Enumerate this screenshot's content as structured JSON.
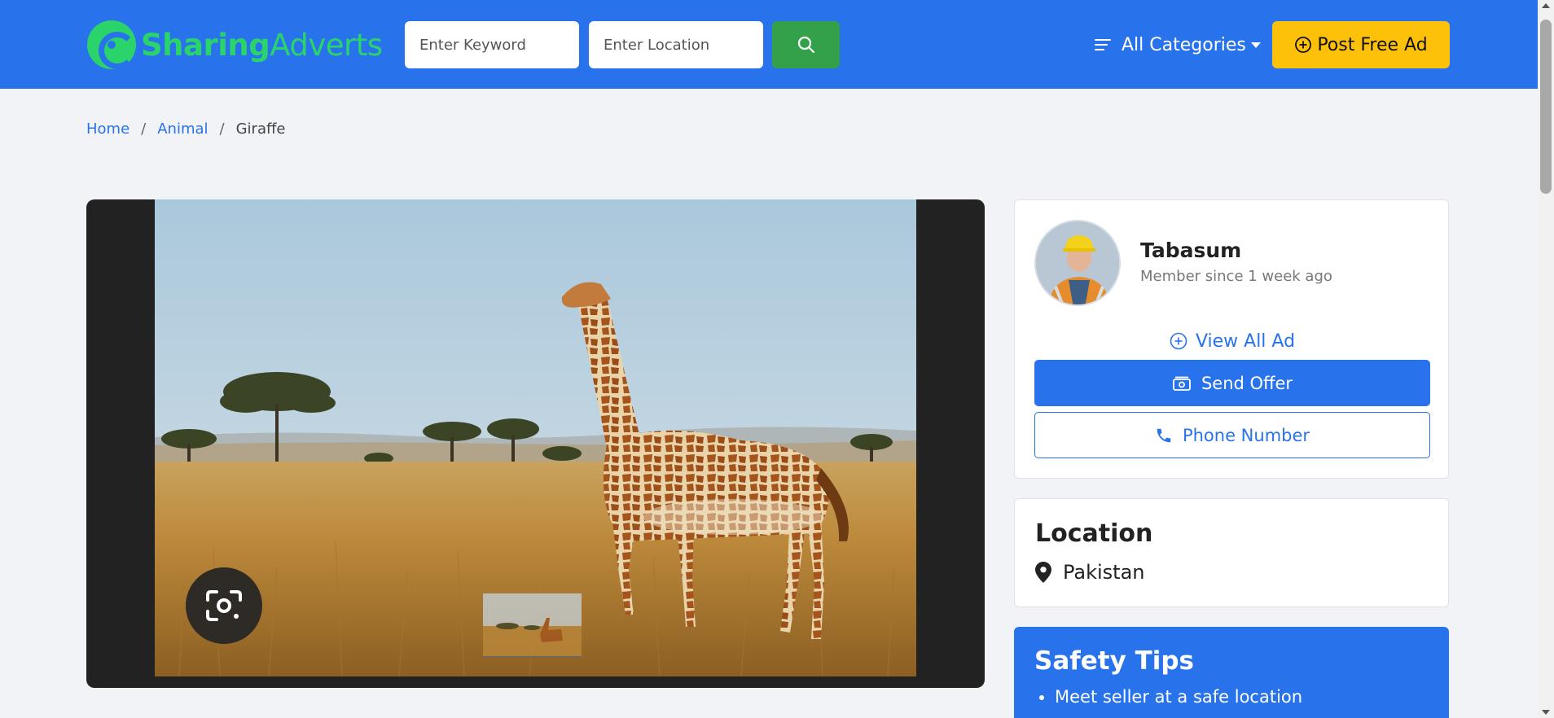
{
  "header": {
    "logo_part1": "Sharing",
    "logo_part2": "Adverts",
    "keyword_placeholder": "Enter Keyword",
    "location_placeholder": "Enter Location",
    "categories_label": "All Categories",
    "post_ad_label": "Post Free Ad"
  },
  "breadcrumb": {
    "home": "Home",
    "category": "Animal",
    "current": "Giraffe",
    "separator": "/"
  },
  "seller": {
    "name": "Tabasum",
    "member_since": "Member since 1 week ago",
    "view_all_label": "View All Ad",
    "send_offer_label": "Send Offer",
    "phone_label": "Phone Number"
  },
  "location": {
    "title": "Location",
    "value": "Pakistan"
  },
  "safety": {
    "title": "Safety Tips",
    "tips": [
      "Meet seller at a safe location"
    ]
  },
  "colors": {
    "primary": "#2873ec",
    "logo_green": "#2bd36b",
    "search_green": "#32a149",
    "post_yellow": "#fec10a",
    "page_bg": "#f1f3f7"
  },
  "icons": {
    "logo": "logo-swirl-icon",
    "search": "search-icon",
    "menu": "menu-lines-icon",
    "post": "plus-circle-icon",
    "lens": "camera-lens-icon",
    "view_all": "plus-circle-icon",
    "offer": "cash-icon",
    "phone": "phone-icon",
    "location": "map-pin-icon"
  }
}
